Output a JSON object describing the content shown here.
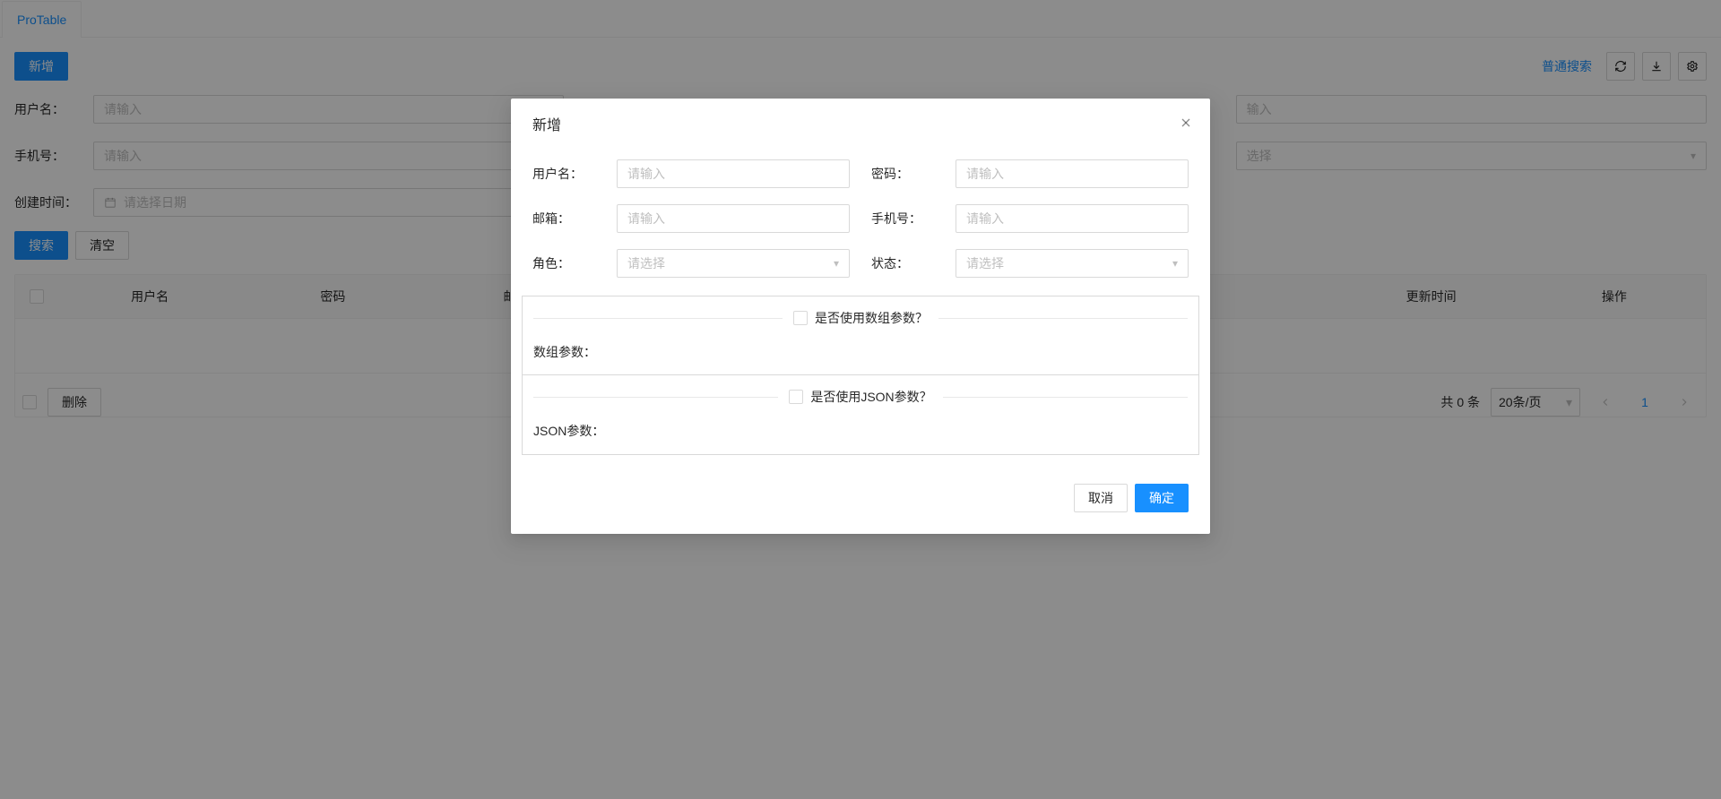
{
  "tab": {
    "label": "ProTable"
  },
  "toolbar": {
    "add_label": "新增",
    "normal_search_label": "普通搜索"
  },
  "search": {
    "fields": {
      "username": {
        "label": "用户名：",
        "placeholder": "请输入"
      },
      "f2": {
        "placeholder": "输入"
      },
      "phone": {
        "label": "手机号：",
        "placeholder": "请输入"
      },
      "f4": {
        "placeholder": "选择"
      },
      "created": {
        "label": "创建时间：",
        "placeholder": "请选择日期"
      }
    },
    "submit_label": "搜索",
    "reset_label": "清空"
  },
  "table": {
    "columns": [
      "用户名",
      "密码",
      "邮箱",
      "",
      "",
      "",
      "",
      "更新时间",
      "操作"
    ],
    "delete_label": "删除",
    "total_prefix": "共",
    "total_count": "0",
    "total_suffix": "条",
    "page_size_label": "20条/页",
    "current_page": "1"
  },
  "modal": {
    "title": "新增",
    "fields": {
      "username": {
        "label": "用户名：",
        "placeholder": "请输入"
      },
      "password": {
        "label": "密码：",
        "placeholder": "请输入"
      },
      "email": {
        "label": "邮箱：",
        "placeholder": "请输入"
      },
      "phone": {
        "label": "手机号：",
        "placeholder": "请输入"
      },
      "role": {
        "label": "角色：",
        "placeholder": "请选择"
      },
      "status": {
        "label": "状态：",
        "placeholder": "请选择"
      }
    },
    "array_params": {
      "question": "是否使用数组参数？",
      "label": "数组参数："
    },
    "json_params": {
      "question": "是否使用JSON参数？",
      "label": "JSON参数："
    },
    "cancel_label": "取消",
    "ok_label": "确定"
  }
}
